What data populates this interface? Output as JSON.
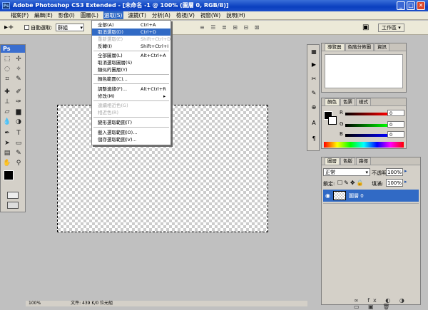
{
  "window": {
    "title": "Adobe Photoshop CS3 Extended - [未命名 -1 @ 100% (圖層 0, RGB/8)]",
    "minimize": "_",
    "maximize": "□",
    "close": "✕",
    "app_icon": "Ps"
  },
  "menubar": {
    "items": [
      "檔案(F)",
      "編輯(E)",
      "影像(I)",
      "圖層(L)",
      "選取(S)",
      "濾鏡(T)",
      "分析(A)",
      "檢視(V)",
      "視窗(W)",
      "說明(H)"
    ]
  },
  "options": {
    "auto_select_label": "自動選取:",
    "auto_select_value": "群組",
    "workspace_label": "工作區 ▾"
  },
  "toolbox": {
    "header": "Ps"
  },
  "select_menu": {
    "items": [
      {
        "label": "全部(A)",
        "shortcut": "Ctrl+A",
        "state": "normal"
      },
      {
        "label": "取消選取(D)",
        "shortcut": "Ctrl+D",
        "state": "highlight"
      },
      {
        "label": "重新選取(E)",
        "shortcut": "Shift+Ctrl+D",
        "state": "disabled"
      },
      {
        "label": "反轉(I)",
        "shortcut": "Shift+Ctrl+I",
        "state": "normal"
      },
      {
        "label": "全部圖層(L)",
        "shortcut": "Alt+Ctrl+A",
        "state": "normal"
      },
      {
        "label": "取消選取圖層(S)",
        "shortcut": "",
        "state": "normal"
      },
      {
        "label": "類似的圖層(Y)",
        "shortcut": "",
        "state": "normal"
      },
      {
        "label": "顏色範圍(C)...",
        "shortcut": "",
        "state": "normal"
      },
      {
        "label": "調整邊緣(F)...",
        "shortcut": "Alt+Ctrl+R",
        "state": "normal"
      },
      {
        "label": "修改(M)",
        "shortcut": "▸",
        "state": "normal"
      },
      {
        "label": "連續相近色(G)",
        "shortcut": "",
        "state": "disabled"
      },
      {
        "label": "相近色(R)",
        "shortcut": "",
        "state": "disabled"
      },
      {
        "label": "變形選取範圍(T)",
        "shortcut": "",
        "state": "normal"
      },
      {
        "label": "載入選取範圍(O)...",
        "shortcut": "",
        "state": "normal"
      },
      {
        "label": "儲存選取範圍(V)...",
        "shortcut": "",
        "state": "normal"
      }
    ]
  },
  "navigator_panel": {
    "tabs": [
      "導覽器",
      "色階分佈圖",
      "資訊"
    ]
  },
  "color_panel": {
    "tabs": [
      "顏色",
      "色票",
      "樣式"
    ],
    "channels": [
      {
        "name": "R",
        "value": "0"
      },
      {
        "name": "G",
        "value": "0"
      },
      {
        "name": "B",
        "value": "0"
      }
    ]
  },
  "layers_panel": {
    "tabs": [
      "圖層",
      "色版",
      "路徑"
    ],
    "blend_mode": "正常",
    "opacity_label": "不透明:",
    "opacity_value": "100%",
    "lock_label": "鎖定:",
    "fill_label": "填滿:",
    "fill_value": "100%",
    "layer_name": "圖層 0"
  },
  "status": {
    "zoom": "100%",
    "doc_info": "文件: 439 K/0 位元組"
  },
  "colors": {
    "title_blue": "#0a3fbf",
    "highlight": "#316ac5",
    "canvas_bg": "#c0c0c0"
  }
}
